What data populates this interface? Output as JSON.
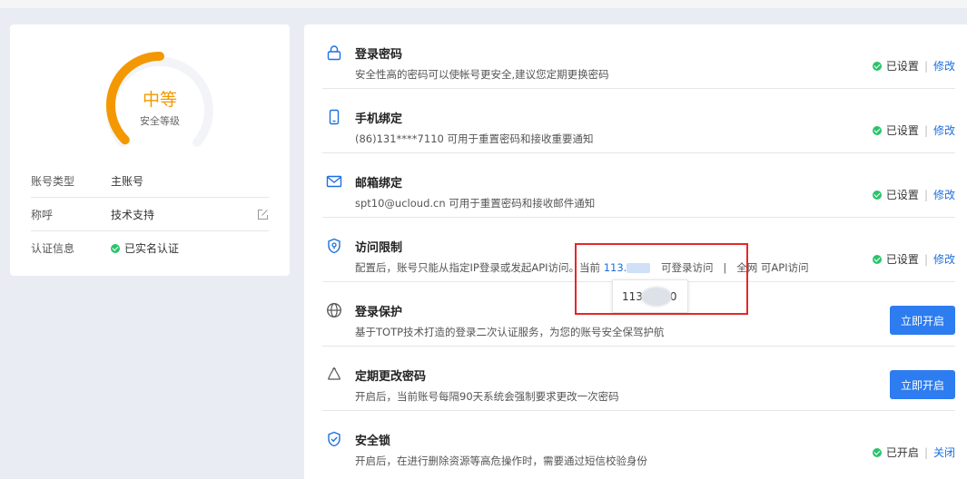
{
  "security_level": {
    "label": "中等",
    "sub_label": "安全等级",
    "level_fraction": 0.5,
    "color": "#f39800"
  },
  "account_info": [
    {
      "label": "账号类型",
      "value": "主账号"
    },
    {
      "label": "称呼",
      "value": "技术支持"
    },
    {
      "label": "认证信息",
      "value": "已实名认证"
    }
  ],
  "items": [
    {
      "icon": "lock-icon",
      "title": "登录密码",
      "desc": "安全性高的密码可以使帐号更安全,建议您定期更换密码",
      "status": "已设置",
      "action": "修改"
    },
    {
      "icon": "phone-icon",
      "title": "手机绑定",
      "desc": "(86)131****7110 可用于重置密码和接收重要通知",
      "status": "已设置",
      "action": "修改"
    },
    {
      "icon": "mail-icon",
      "title": "邮箱绑定",
      "desc": "spt10@ucloud.cn 可用于重置密码和接收邮件通知",
      "status": "已设置",
      "action": "修改"
    },
    {
      "icon": "shield-icon",
      "title": "访问限制",
      "desc_prefix": "配置后，账号只能从指定IP登录或发起API访问。当前",
      "ip_value": "113.",
      "desc_login": "可登录访问",
      "desc_sep": "|",
      "desc_api": "全网 可API访问",
      "status": "已设置",
      "action": "修改"
    },
    {
      "icon": "globe-icon",
      "title": "登录保护",
      "desc": "基于TOTP技术打造的登录二次认证服务，为您的账号安全保驾护航",
      "button": "立即开启"
    },
    {
      "icon": "recycle-icon",
      "title": "定期更改密码",
      "desc": "开启后，当前账号每隔90天系统会强制要求更改一次密码",
      "button": "立即开启"
    },
    {
      "icon": "shield-check-icon",
      "title": "安全锁",
      "desc": "开启后，在进行删除资源等高危操作时，需要通过短信校验身份",
      "status": "已开启",
      "action": "关闭"
    }
  ],
  "tooltip": {
    "prefix": "113",
    "suffix": "0"
  },
  "colors": {
    "accent": "#2d7cf0",
    "link": "#1e6fe0",
    "ok": "#2cc36b",
    "highlight": "#e52727"
  }
}
